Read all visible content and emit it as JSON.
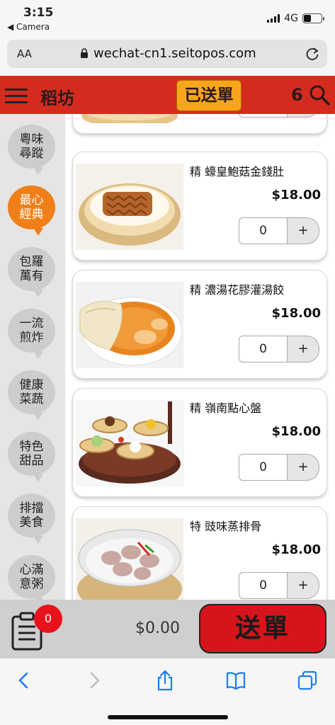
{
  "status_bar": {
    "time": "3:15",
    "back_app": "◀ Camera",
    "network": "4G"
  },
  "browser": {
    "aa_label": "AA",
    "url": "wechat-cn1.seitopos.com"
  },
  "header": {
    "shop_name": "稻坊",
    "sent_button": "已送單",
    "count": "6"
  },
  "sidebar": {
    "categories": [
      {
        "label": "粵味尋蹤",
        "active": false
      },
      {
        "label": "最心經典",
        "active": true
      },
      {
        "label": "包羅萬有",
        "active": false
      },
      {
        "label": "一流煎炸",
        "active": false
      },
      {
        "label": "健康菜蔬",
        "active": false
      },
      {
        "label": "特色甜品",
        "active": false
      },
      {
        "label": "排擋美食",
        "active": false
      },
      {
        "label": "心滿意粥",
        "active": false
      }
    ]
  },
  "menu_items": [
    {
      "name": "",
      "price": "",
      "qty": "",
      "plus": "+"
    },
    {
      "name": "精 蠔皇鮑菇金錢肚",
      "price": "$18.00",
      "qty": "0",
      "plus": "+"
    },
    {
      "name": "精 濃湯花膠灌湯餃",
      "price": "$18.00",
      "qty": "0",
      "plus": "+"
    },
    {
      "name": "精 嶺南點心盤",
      "price": "$18.00",
      "qty": "0",
      "plus": "+"
    },
    {
      "name": "特 豉味蒸排骨",
      "price": "$18.00",
      "qty": "0",
      "plus": "+"
    }
  ],
  "order_bar": {
    "badge_count": "0",
    "total": "$0.00",
    "submit_label": "送單"
  },
  "colors": {
    "header_red": "#d52b1e",
    "accent_orange": "#f07f18",
    "sent_button": "#f7a51c",
    "submit_red": "#d6141c",
    "ios_blue": "#1a7cf5"
  },
  "icons": [
    "menu-icon",
    "search-icon",
    "lock-icon",
    "reload-icon",
    "order-list-icon",
    "back-icon",
    "forward-icon",
    "share-icon",
    "bookmarks-icon",
    "tabs-icon"
  ]
}
